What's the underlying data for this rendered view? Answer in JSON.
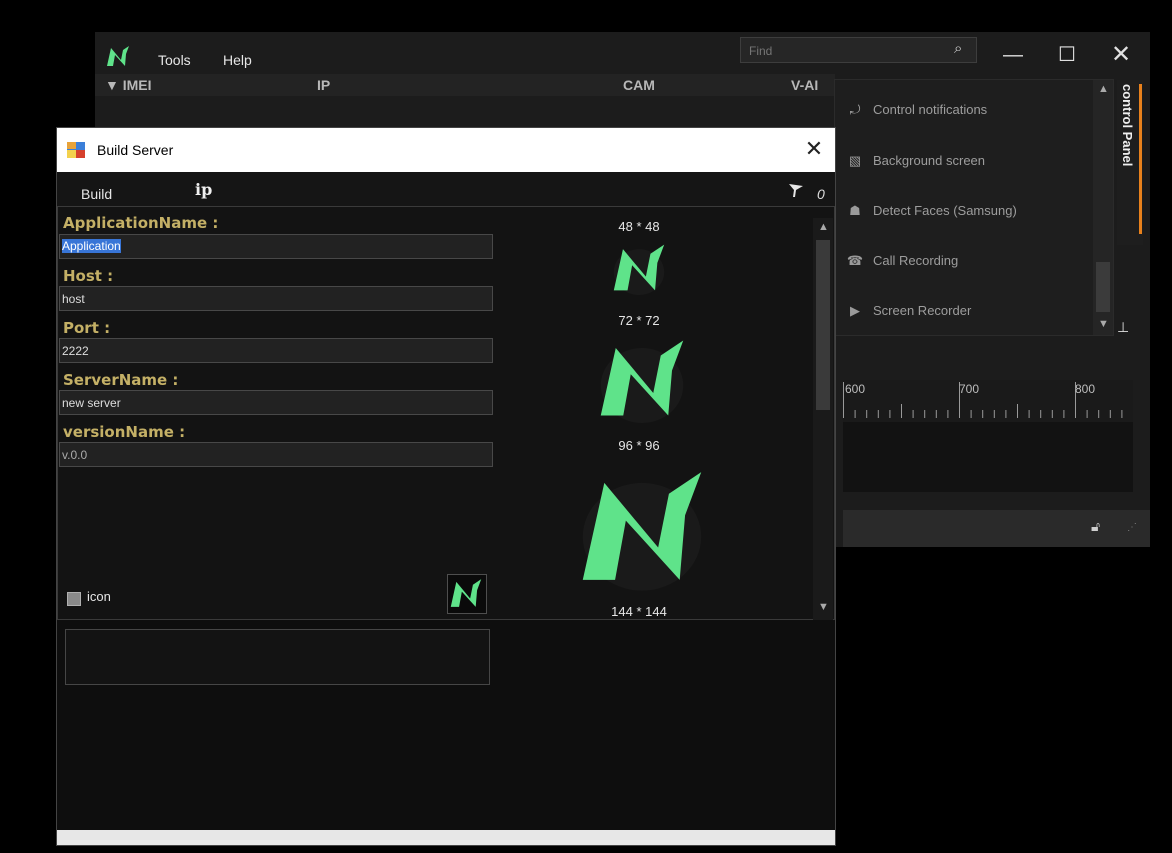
{
  "main_window": {
    "menu": [
      "Tools",
      "Help"
    ],
    "find_placeholder": "Find",
    "grid_columns": [
      "▼ IMEI",
      "IP",
      "CAM",
      "V-AI"
    ]
  },
  "control_panel": {
    "tab_label": "control Panel",
    "items": [
      {
        "label": "Control notifications",
        "icon": "notification-icon"
      },
      {
        "label": "Background screen",
        "icon": "wallpaper-icon"
      },
      {
        "label": "Detect Faces (Samsung)",
        "icon": "face-detect-icon"
      },
      {
        "label": "Call Recording",
        "icon": "phone-icon"
      },
      {
        "label": "Screen Recorder",
        "icon": "camera-icon"
      }
    ],
    "accent_color": "#e8811c"
  },
  "ruler": {
    "labels": [
      "600",
      "700",
      "800"
    ]
  },
  "dialog": {
    "title": "Build Server",
    "menu_build": "Build",
    "menu_ip": "ip",
    "menu_count": "0",
    "fields": [
      {
        "label": "ApplicationName :",
        "value": "Application"
      },
      {
        "label": "Host :",
        "value": "host"
      },
      {
        "label": "Port :",
        "value": "2222"
      },
      {
        "label": "ServerName :",
        "value": "new server"
      },
      {
        "label": "versionName :",
        "value": "v.0.0"
      }
    ],
    "checkbox_label": "icon",
    "icon_sizes": [
      "48 * 48",
      "72 * 72",
      "96 * 96",
      "144 * 144"
    ],
    "label_color": "#c4b066",
    "logo_color": "#5fe38a"
  }
}
